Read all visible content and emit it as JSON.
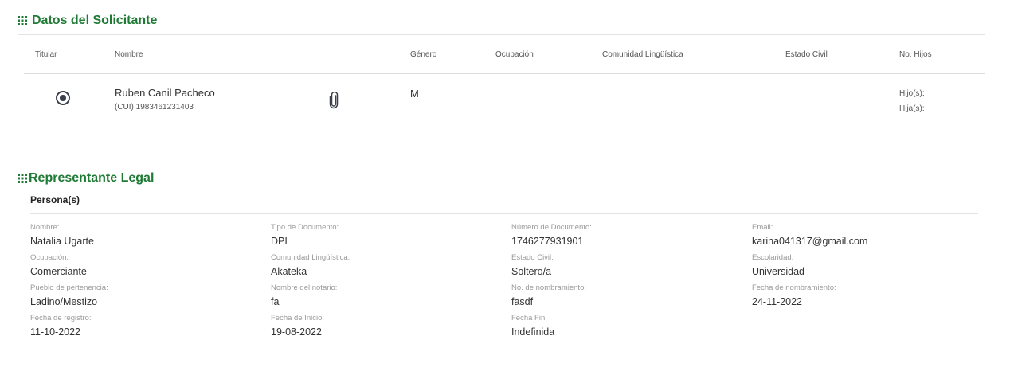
{
  "solicitante": {
    "title": "Datos del Solicitante",
    "columns": {
      "titular": "Titular",
      "nombre": "Nombre",
      "genero": "Género",
      "ocupacion": "Ocupación",
      "comunidad": "Comunidad Lingüística",
      "estado_civil": "Estado Civil",
      "no_hijos": "No. Hijos"
    },
    "row": {
      "titular_selected": true,
      "nombre": "Ruben Canil Pacheco",
      "cui": "(CUI) 1983461231403",
      "genero": "M",
      "hijos_label": "Hijo(s):",
      "hijas_label": "Hija(s):"
    }
  },
  "representante": {
    "title": "Representante Legal",
    "subtitle": "Persona(s)",
    "fields": [
      {
        "label": "Nombre:",
        "value": "Natalia Ugarte"
      },
      {
        "label": "Tipo de Documento:",
        "value": "DPI"
      },
      {
        "label": "Número de Documento:",
        "value": "1746277931901"
      },
      {
        "label": "Email:",
        "value": "karina041317@gmail.com"
      },
      {
        "label": "Ocupación:",
        "value": "Comerciante"
      },
      {
        "label": "Comunidad Lingüística:",
        "value": "Akateka"
      },
      {
        "label": "Estado Civil:",
        "value": "Soltero/a"
      },
      {
        "label": "Escolaridad:",
        "value": "Universidad"
      },
      {
        "label": "Pueblo de pertenencia:",
        "value": "Ladino/Mestizo"
      },
      {
        "label": "Nombre del notario:",
        "value": "fa"
      },
      {
        "label": "No. de nombramiento:",
        "value": "fasdf"
      },
      {
        "label": "Fecha de nombramiento:",
        "value": "24-11-2022"
      },
      {
        "label": "Fecha de registro:",
        "value": "11-10-2022"
      },
      {
        "label": "Fecha de Inicio:",
        "value": "19-08-2022"
      },
      {
        "label": "Fecha Fin:",
        "value": "Indefinida"
      }
    ]
  },
  "colors": {
    "accent": "#1e7a34",
    "divider": "#e3e3e3",
    "label": "#9a9a9a"
  },
  "icons": {
    "grip": "grip-dots-icon",
    "radio": "radio-selected-icon",
    "attachment": "paperclip-icon"
  }
}
